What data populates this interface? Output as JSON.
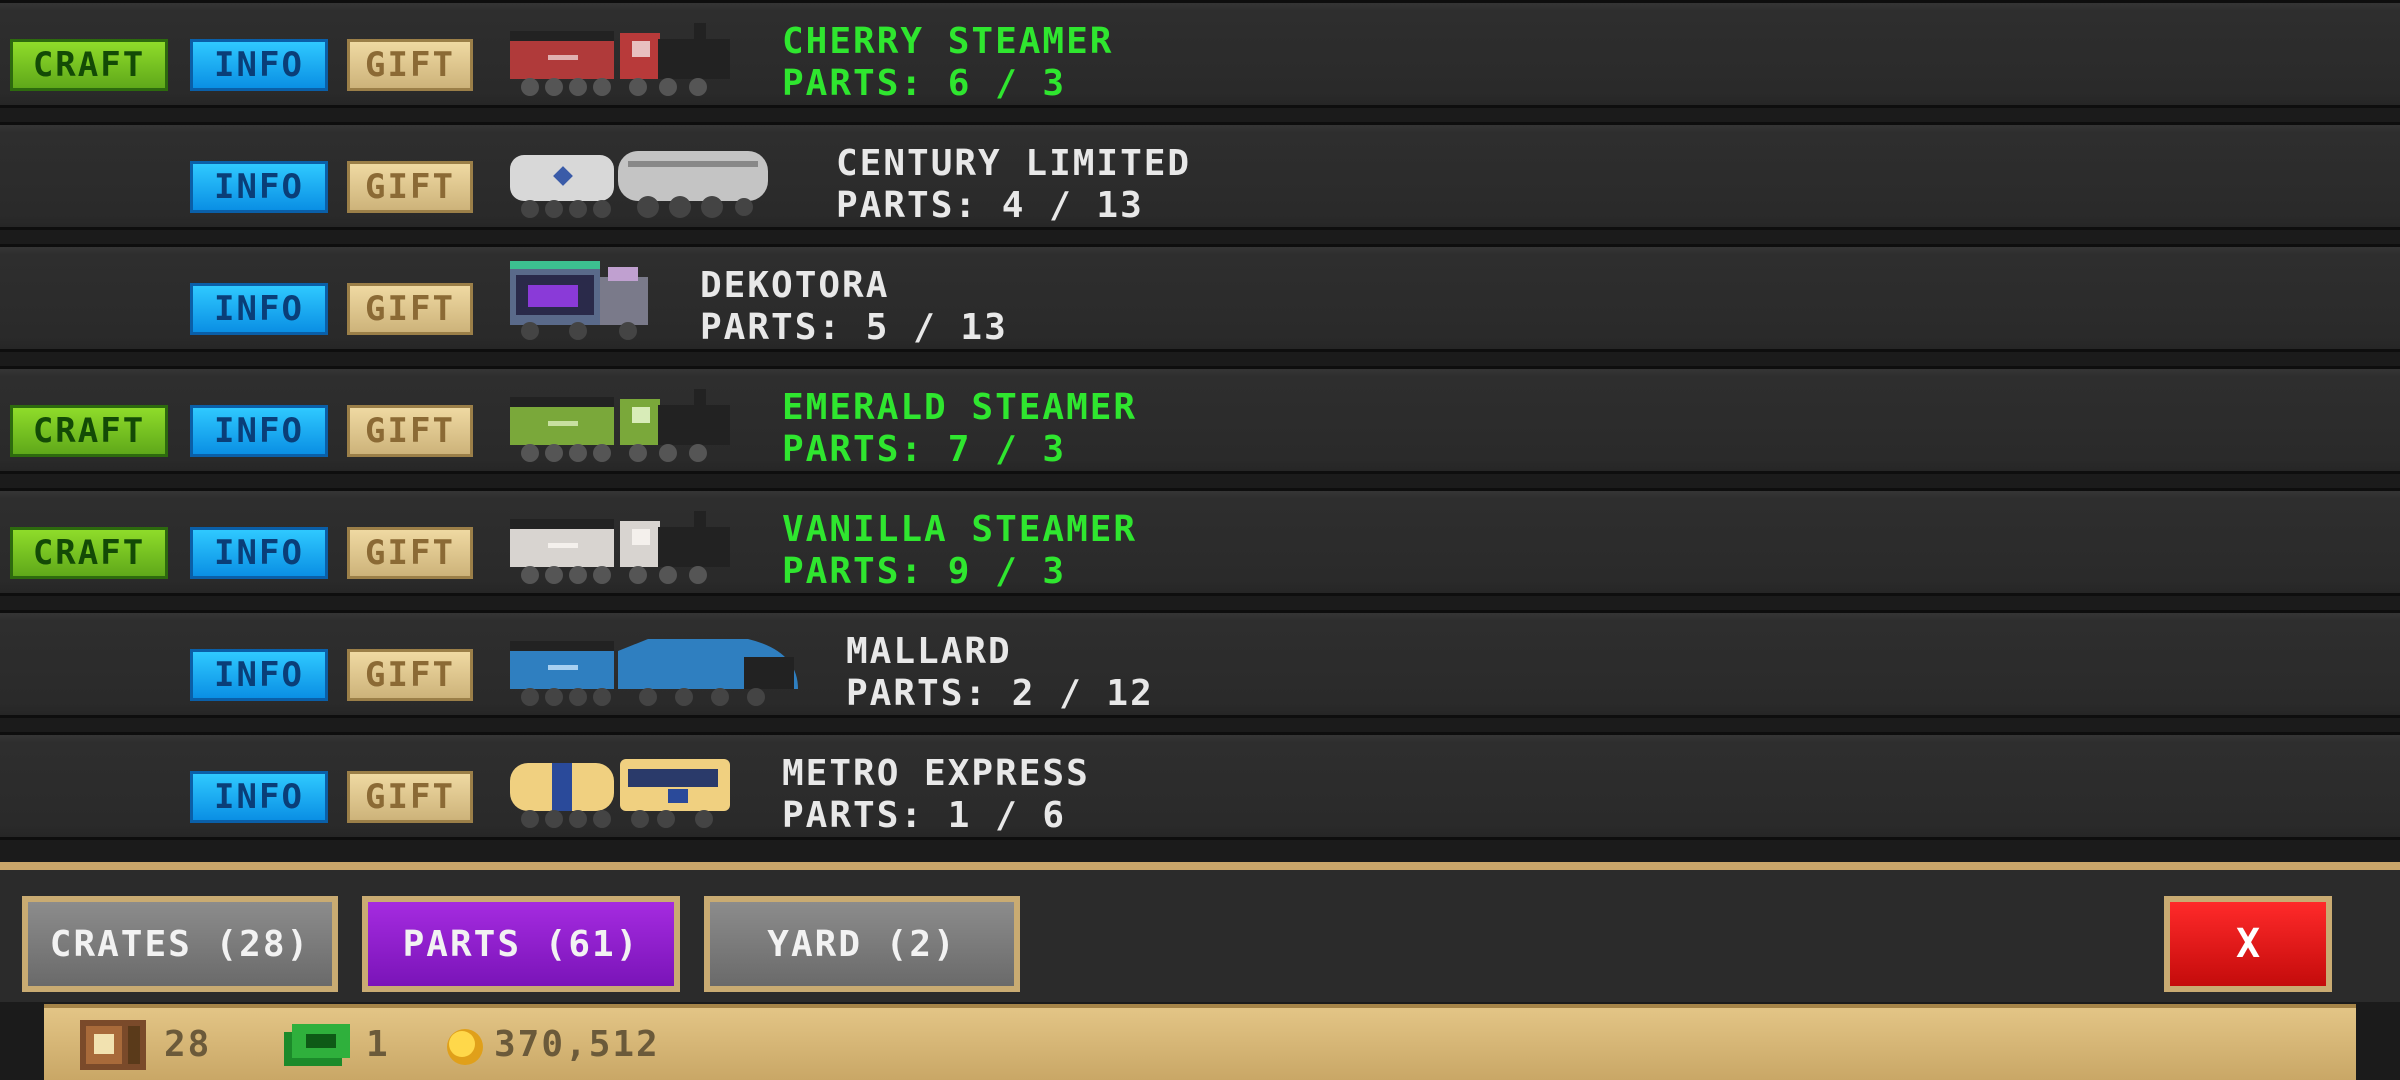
{
  "rows": [
    {
      "craft_label": "CRAFT",
      "info_label": "INFO",
      "gift_label": "GIFT",
      "train_name": "CHERRY STEAMER",
      "parts": "PARTS: 6 / 3"
    },
    {
      "info_label": "INFO",
      "gift_label": "GIFT",
      "train_name": "CENTURY LIMITED",
      "parts": "PARTS: 4 / 13"
    },
    {
      "info_label": "INFO",
      "gift_label": "GIFT",
      "train_name": "DEKOTORA",
      "parts": "PARTS: 5 / 13"
    },
    {
      "craft_label": "CRAFT",
      "info_label": "INFO",
      "gift_label": "GIFT",
      "train_name": "EMERALD STEAMER",
      "parts": "PARTS: 7 / 3"
    },
    {
      "craft_label": "CRAFT",
      "info_label": "INFO",
      "gift_label": "GIFT",
      "train_name": "VANILLA STEAMER",
      "parts": "PARTS: 9 / 3"
    },
    {
      "info_label": "INFO",
      "gift_label": "GIFT",
      "train_name": "MALLARD",
      "parts": "PARTS: 2 / 12"
    },
    {
      "info_label": "INFO",
      "gift_label": "GIFT",
      "train_name": "METRO EXPRESS",
      "parts": "PARTS: 1 / 6"
    }
  ],
  "tabs": {
    "crates": "CRATES (28)",
    "parts": "PARTS (61)",
    "yard": "YARD (2)",
    "close": "X"
  },
  "status": {
    "crates_count": "28",
    "cash_count": "1",
    "coins": "370,512"
  },
  "colors": {
    "craftable_text": "#2fe62f",
    "normal_text": "#e8e8e8",
    "tab_active": "#a52be0",
    "close_button": "#ff2a2a"
  }
}
